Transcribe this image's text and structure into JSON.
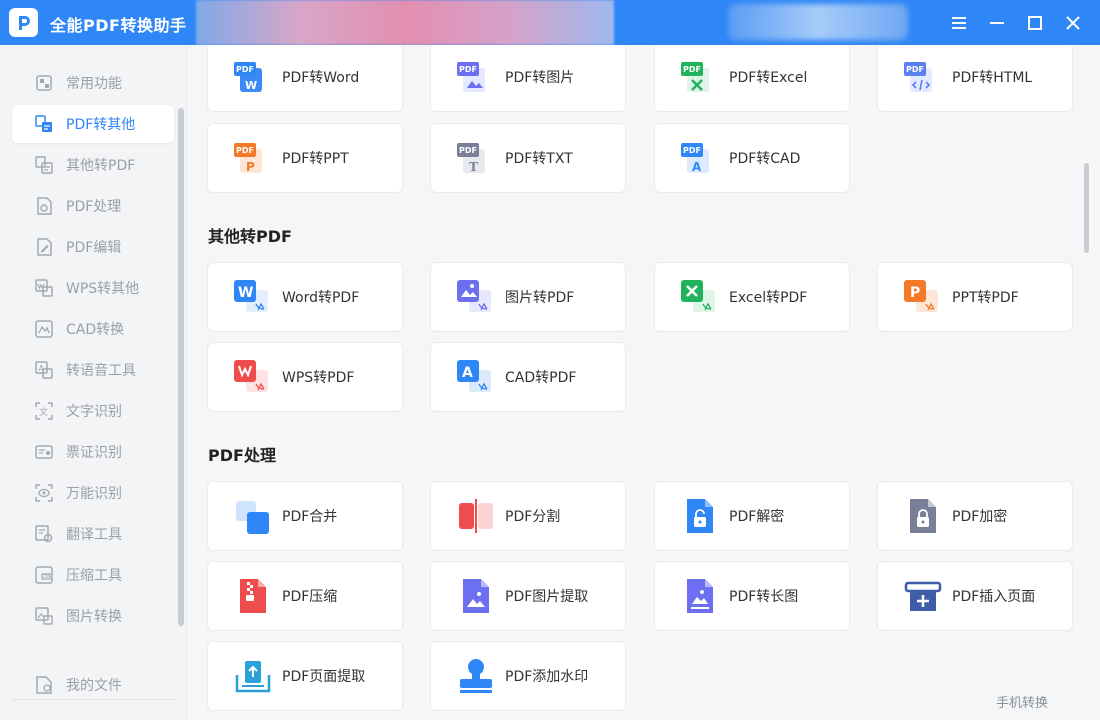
{
  "app": {
    "title": "全能PDF转换助手"
  },
  "titlebar": {
    "menu_icon": "menu-icon",
    "minimize_icon": "minimize-icon",
    "maximize_icon": "maximize-icon",
    "close_icon": "close-icon"
  },
  "sidebar": {
    "items": [
      {
        "label": "常用功能",
        "icon": "star-icon"
      },
      {
        "label": "PDF转其他",
        "icon": "pdf-convert-icon"
      },
      {
        "label": "其他转PDF",
        "icon": "to-pdf-icon"
      },
      {
        "label": "PDF处理",
        "icon": "pdf-process-icon"
      },
      {
        "label": "PDF编辑",
        "icon": "pdf-edit-icon"
      },
      {
        "label": "WPS转其他",
        "icon": "wps-icon"
      },
      {
        "label": "CAD转换",
        "icon": "cad-icon"
      },
      {
        "label": "转语音工具",
        "icon": "speech-icon"
      },
      {
        "label": "文字识别",
        "icon": "ocr-icon"
      },
      {
        "label": "票证识别",
        "icon": "ticket-icon"
      },
      {
        "label": "万能识别",
        "icon": "eye-icon"
      },
      {
        "label": "翻译工具",
        "icon": "translate-icon"
      },
      {
        "label": "压缩工具",
        "icon": "zip-icon"
      },
      {
        "label": "图片转换",
        "icon": "image-icon"
      }
    ],
    "my_files": "我的文件",
    "active_index": 1
  },
  "sections": {
    "pdf_to_other": {
      "cards": [
        "PDF转Word",
        "PDF转图片",
        "PDF转Excel",
        "PDF转HTML",
        "PDF转PPT",
        "PDF转TXT",
        "PDF转CAD"
      ]
    },
    "other_to_pdf": {
      "title": "其他转PDF",
      "cards": [
        "Word转PDF",
        "图片转PDF",
        "Excel转PDF",
        "PPT转PDF",
        "WPS转PDF",
        "CAD转PDF"
      ]
    },
    "pdf_process": {
      "title": "PDF处理",
      "cards": [
        "PDF合并",
        "PDF分割",
        "PDF解密",
        "PDF加密",
        "PDF压缩",
        "PDF图片提取",
        "PDF转长图",
        "PDF插入页面",
        "PDF页面提取",
        "PDF添加水印"
      ]
    }
  },
  "footer": {
    "mobile_convert": "手机转换"
  },
  "colors": {
    "accent": "#2f86f6",
    "pdf_tag": "#2f86f6",
    "word": "#2f86f6",
    "excel": "#21b35c",
    "ppt": "#f47a2a",
    "txt": "#7a7f99",
    "wps": "#ef4d4d",
    "purple": "#6b6ff0"
  }
}
